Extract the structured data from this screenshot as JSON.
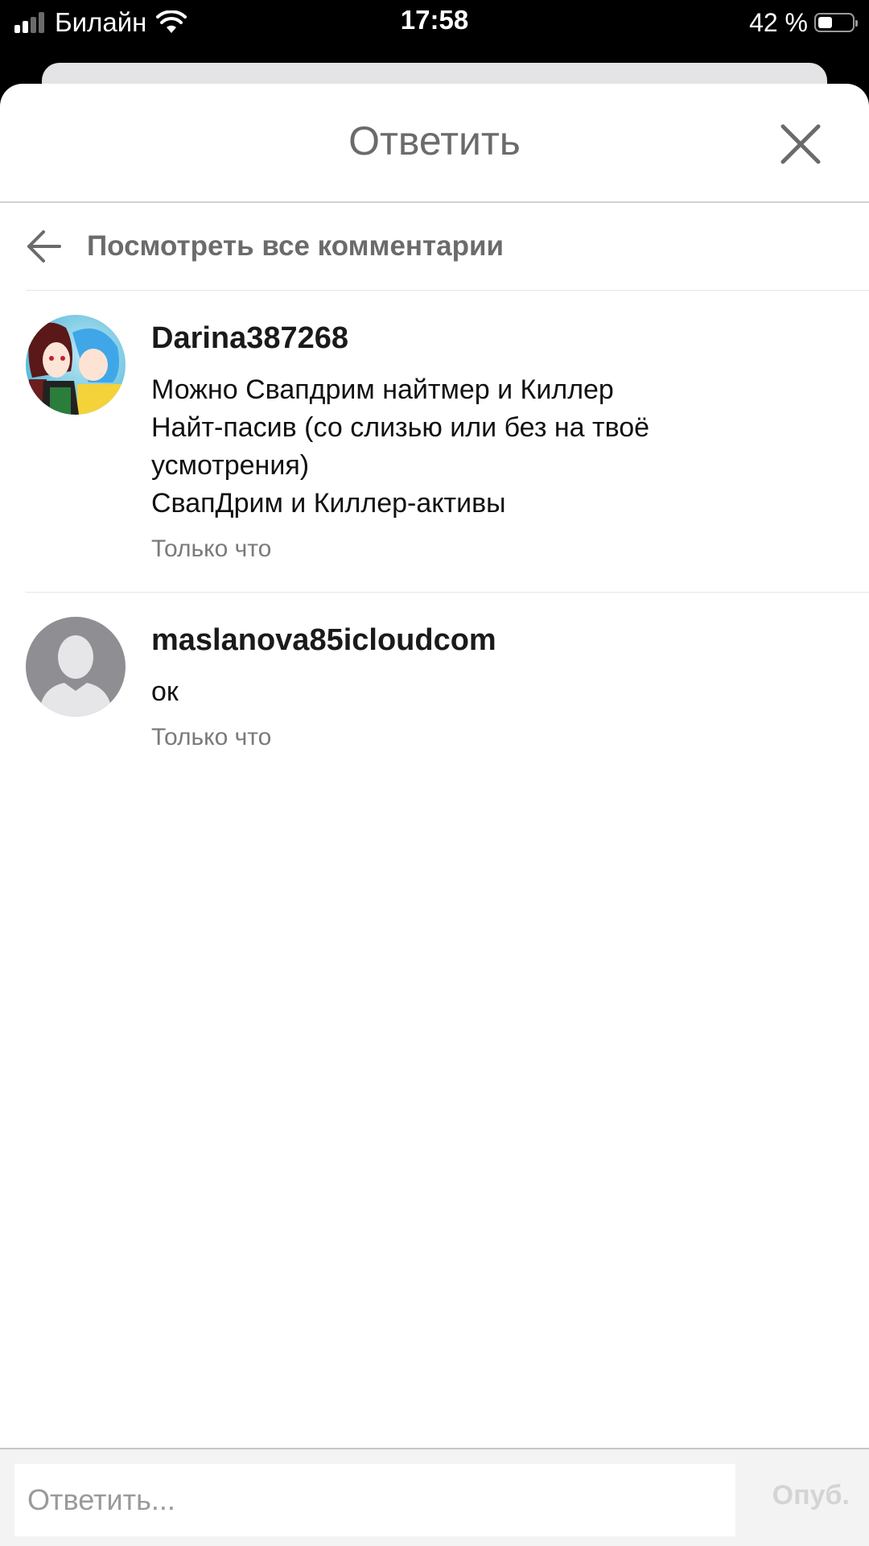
{
  "status_bar": {
    "carrier": "Билайн",
    "time": "17:58",
    "battery_percent": "42 %",
    "battery_level": 0.42,
    "signal_bars_active": 2
  },
  "header": {
    "title": "Ответить"
  },
  "view_all": {
    "label": "Посмотреть все комментарии"
  },
  "comments": [
    {
      "username": "Darina387268",
      "lines": [
        "Можно Свапдрим найтмер и Киллер",
        "Найт-пасив (со слизью или без на твоё",
        "усмотрения)",
        "СвапДрим и Киллер-активы"
      ],
      "time": "Только что",
      "avatar": "anime-art-avatar"
    },
    {
      "username": "maslanova85icloudcom",
      "lines": [
        "ок"
      ],
      "time": "Только что",
      "avatar": "default-person-avatar"
    }
  ],
  "reply": {
    "placeholder": "Ответить...",
    "publish_label": "Опуб."
  },
  "colors": {
    "header_text": "#6b6b6b",
    "publish_disabled": "#d4d4d4",
    "default_avatar_bg": "#8e8e93"
  }
}
